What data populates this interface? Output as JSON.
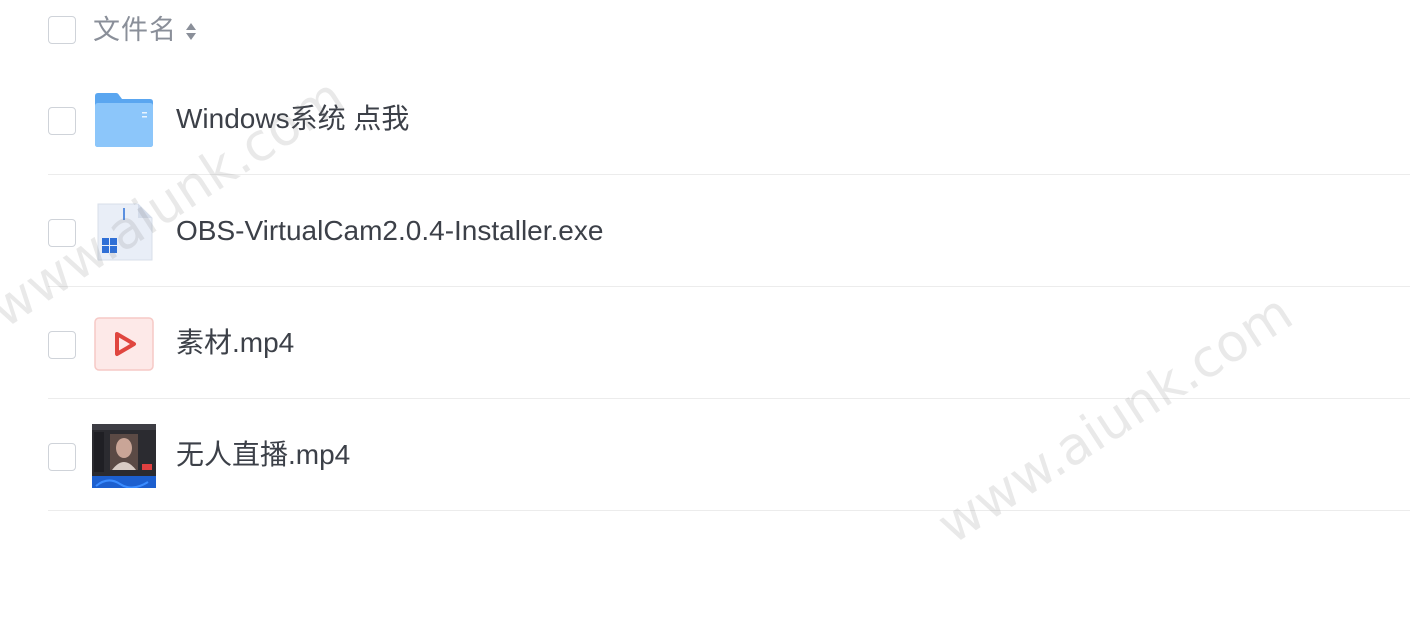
{
  "header": {
    "column_label": "文件名",
    "sort_icon": "sort-updown-icon"
  },
  "files": [
    {
      "name": "Windows系统 点我",
      "icon": "folder-icon"
    },
    {
      "name": "OBS-VirtualCam2.0.4-Installer.exe",
      "icon": "exe-file-icon"
    },
    {
      "name": "素材.mp4",
      "icon": "video-file-icon"
    },
    {
      "name": "无人直播.mp4",
      "icon": "video-thumbnail-icon"
    }
  ],
  "watermark": {
    "text": "www.aiunk.com"
  },
  "colors": {
    "folder": "#6fb4f5",
    "video_accent": "#e0463f",
    "text": "#3c4048",
    "muted": "#8a8f99",
    "divider": "#ececec"
  }
}
